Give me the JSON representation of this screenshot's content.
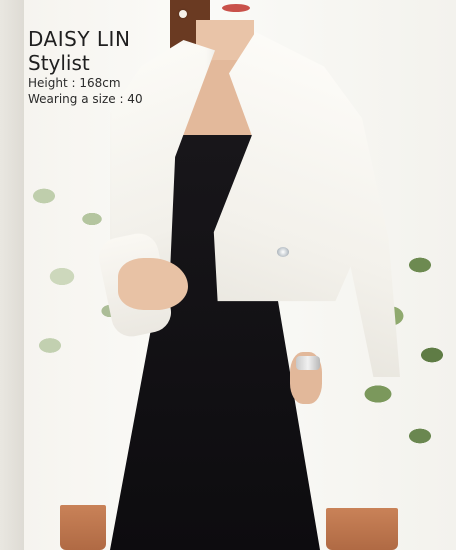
{
  "caption": {
    "name": "DAISY LIN",
    "role": "Stylist",
    "height": "Height : 168cm",
    "size": "Wearing a size : 40"
  },
  "image": {
    "subject": "model-photo",
    "colors": {
      "jacket": "#f6f4ef",
      "dress": "#111014",
      "background": "#f4f3ef",
      "plants": "#7f9a61",
      "pots": "#c07a50"
    }
  }
}
